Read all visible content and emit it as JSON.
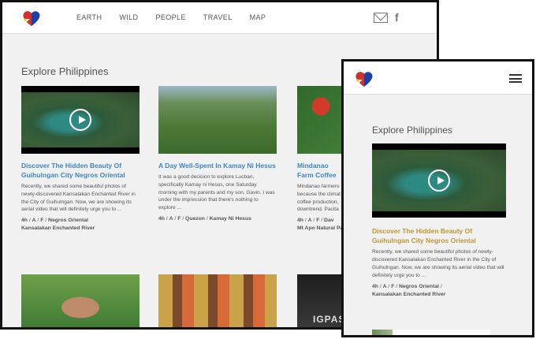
{
  "desktop": {
    "nav": [
      "EARTH",
      "WILD",
      "PEOPLE",
      "TRAVEL",
      "MAP"
    ],
    "section_title": "Explore Philippines",
    "cards": [
      {
        "title": "Discover The Hidden Beauty Of Guihulngan City Negros Oriental",
        "body": "Recently, we shared some beautiful photos of newly-discovered Kansalakan Enchanted River in the City of Guihulngan. Now, we are showing its aerial video that will definitely urge you to ...",
        "meta_time": "4h",
        "meta_a": "A",
        "meta_f": "F",
        "meta_place": "Negros Oriental",
        "meta_tag": "Kansalakan Enchanted River"
      },
      {
        "title": "A Day Well-Spent In Kamay Ni Hesus",
        "body": "It was a good decision to explore Lucban, specifically Kamay ni Hesus, one Saturday morning with my parents and my son, Gavin. I was under the impression that there's nothing to explore ...",
        "meta_time": "4h",
        "meta_a": "A",
        "meta_f": "F",
        "meta_place": "Quezon",
        "meta_tag": "Kamay Ni Hesus"
      },
      {
        "title": "Mindanao Farm Coffee",
        "body": "Mindanao farmers because the climat coffee production, downtrend. Pacita",
        "meta_time": "4h",
        "meta_a": "A",
        "meta_f": "F",
        "meta_place": "Dav",
        "meta_tag": "Mt Apo Natural Pa"
      }
    ],
    "lower_overlay_text": "IGPASU"
  },
  "mobile": {
    "section_title": "Explore Philippines",
    "card": {
      "title": "Discover The Hidden Beauty Of Guihulngan City Negros Oriental",
      "body": "Recently, we shared some beautiful photos of newly-discovered Kansalakan Enchanted River in the City of Guihulngan. Now, we are showing its aerial video that will definitely urge you to ...",
      "meta_time": "4h",
      "meta_a": "A",
      "meta_f": "F",
      "meta_place": "Negros Oriental",
      "meta_tag": "Kansalakan Enchanted River"
    }
  },
  "icons": {
    "logo": "philippines-heart-logo-icon",
    "mail": "mail-icon",
    "facebook": "facebook-icon",
    "menu": "hamburger-menu-icon",
    "play": "play-icon"
  },
  "colors": {
    "link_blue": "#3a87c8",
    "link_gold": "#c09733",
    "flag_blue": "#1f3fa8",
    "flag_red": "#d32f2f",
    "flag_yellow": "#f4c20d"
  }
}
